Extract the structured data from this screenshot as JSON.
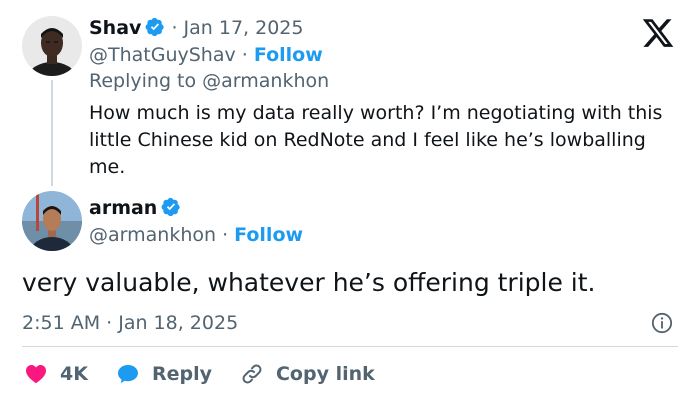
{
  "parent_tweet": {
    "author_name": "Shav",
    "date": "Jan 17, 2025",
    "handle": "@ThatGuyShav",
    "follow_label": "Follow",
    "replying_to": "Replying to @armankhon",
    "text": "How much is my data really worth? I’m negotiating with this little Chinese kid on RedNote and I feel like he’s lowballing me."
  },
  "main_tweet": {
    "author_name": "arman",
    "handle": "@armankhon",
    "follow_label": "Follow",
    "text": "very valuable, whatever he’s offering triple it.",
    "timestamp": "2:51 AM · Jan 18, 2025"
  },
  "actions": {
    "like_count": "4K",
    "reply_label": "Reply",
    "copy_link_label": "Copy link"
  },
  "colors": {
    "accent": "#1d9bf0",
    "like": "#f91880",
    "muted_text": "#536471",
    "primary_text": "#0f1419",
    "divider": "#cfd9de"
  },
  "icons": {
    "brand": "x-logo-icon",
    "verified": "verified-badge-icon",
    "info": "info-icon",
    "like": "heart-icon",
    "reply": "speech-bubble-icon",
    "copy_link": "link-icon"
  }
}
